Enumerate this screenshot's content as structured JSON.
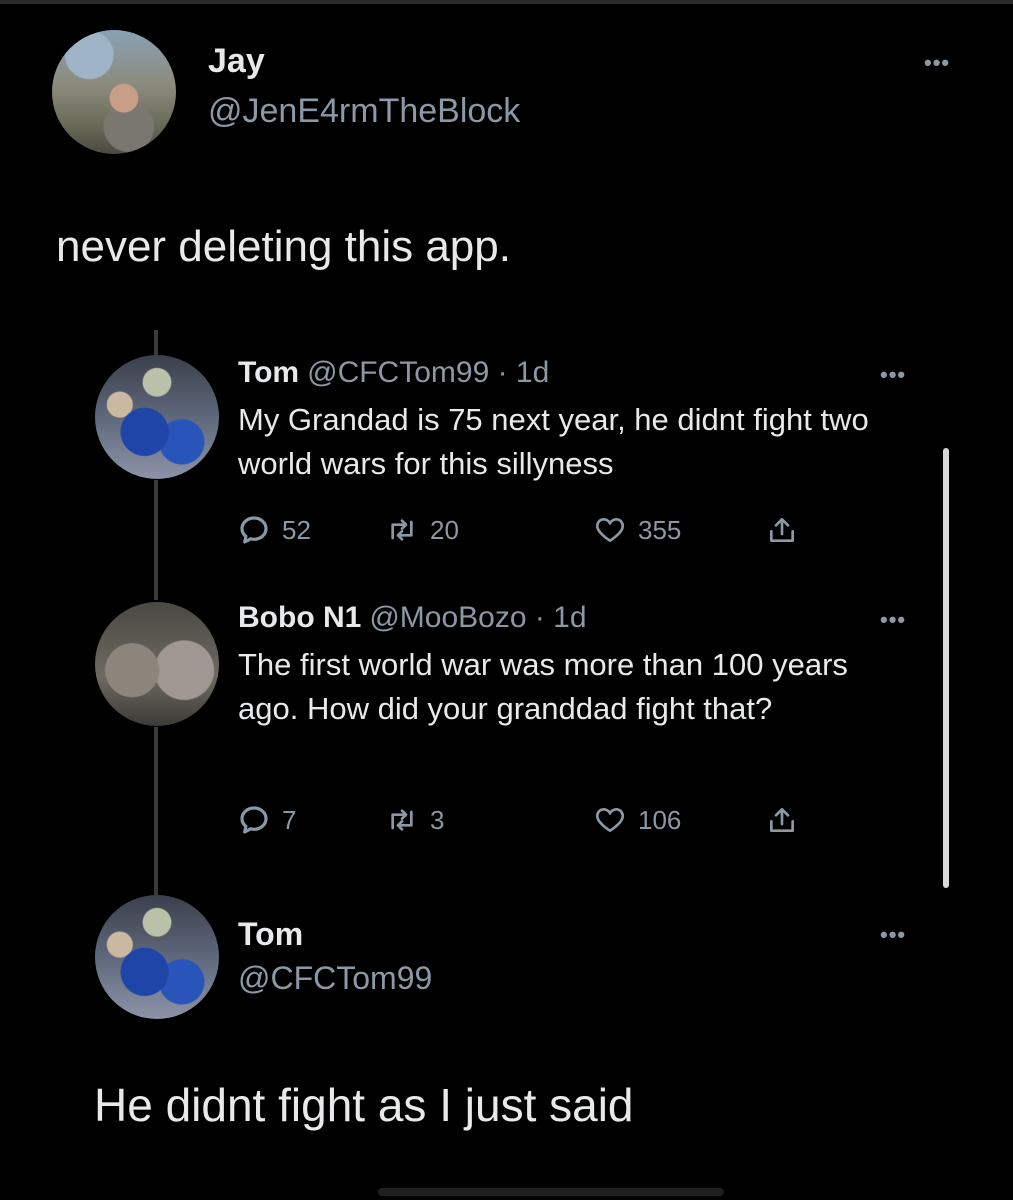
{
  "main_tweet": {
    "author_name": "Jay",
    "author_handle": "@JenE4rmTheBlock",
    "text": "never deleting this app."
  },
  "quoted_thread": [
    {
      "author_name": "Tom",
      "header_rest": "@CFCTom99 · 1d",
      "text": "My Grandad is 75 next year,  he didnt fight two world wars for this sillyness",
      "replies": "52",
      "retweets": "20",
      "likes": "355"
    },
    {
      "author_name": "Bobo N1",
      "header_rest": "@MooBozo · 1d",
      "text": "The first world war was more than 100 years ago. How did your granddad fight that?",
      "replies": "7",
      "retweets": "3",
      "likes": "106"
    }
  ],
  "reply_tweet": {
    "author_name": "Tom",
    "author_handle": "@CFCTom99",
    "text": "He didnt fight as I just said"
  },
  "icons": {
    "more": "more-icon",
    "reply": "reply-icon",
    "retweet": "retweet-icon",
    "like": "heart-icon",
    "share": "share-icon"
  },
  "colors": {
    "background": "#000000",
    "text": "#e7e9ea",
    "secondary": "#8b98a5"
  }
}
